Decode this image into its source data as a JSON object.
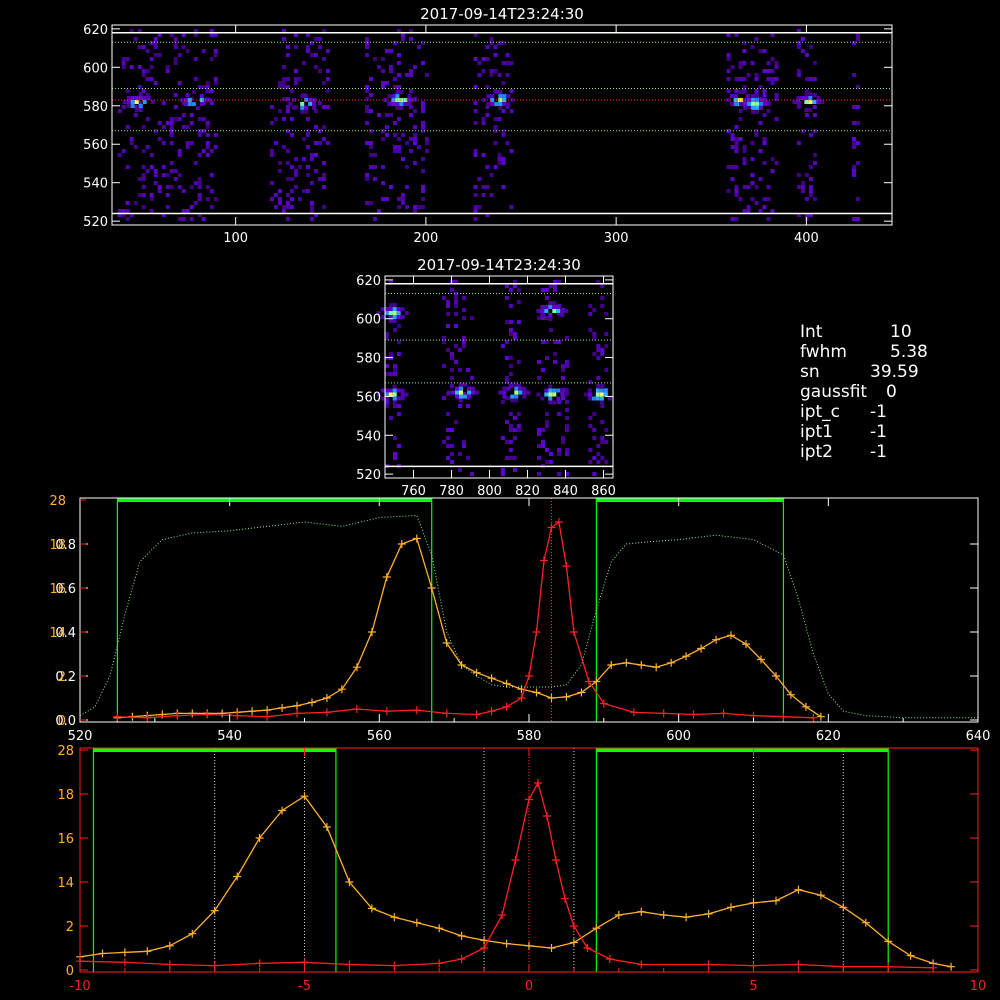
{
  "info": {
    "int": {
      "label": "Int",
      "value": "10"
    },
    "fwhm": {
      "label": "fwhm",
      "value": "5.38"
    },
    "sn": {
      "label": "sn",
      "value": "39.59"
    },
    "gaussfit": {
      "label": "gaussfit",
      "value": "0"
    },
    "ipt_c": {
      "label": "ipt_c",
      "value": "-1"
    },
    "ipt1": {
      "label": "ipt1",
      "value": "-1"
    },
    "ipt2": {
      "label": "ipt2",
      "value": "-1"
    }
  },
  "colors": {
    "axes": "#ffffff",
    "red_series": "#ff2020",
    "orange_series": "#ffb030",
    "green": "#00ff00",
    "dotted_white": "#d8d8d8",
    "dotted_green": "#90ee90",
    "dotted_red": "#ff3030"
  },
  "chart_data": [
    {
      "id": "top",
      "type": "heatmap",
      "title": "2017-09-14T23:24:30",
      "xlim": [
        35,
        445
      ],
      "ylim": [
        518,
        622
      ],
      "xticks": [
        100,
        200,
        300,
        400
      ],
      "yticks": [
        520,
        540,
        560,
        580,
        600,
        620
      ],
      "solid_hlines": [
        524,
        618
      ],
      "dotted_green_hlines": [
        567,
        589,
        613
      ],
      "dotted_red_hline": 583,
      "column_bands": [
        [
          38,
          90
        ],
        [
          118,
          148
        ],
        [
          168,
          200
        ],
        [
          225,
          245
        ],
        [
          358,
          385
        ],
        [
          395,
          405
        ],
        [
          424,
          428
        ]
      ],
      "bright_spots": [
        [
          48,
          583
        ],
        [
          78,
          584
        ],
        [
          135,
          582
        ],
        [
          185,
          584
        ],
        [
          237,
          584
        ],
        [
          365,
          584
        ],
        [
          372,
          582
        ],
        [
          400,
          583
        ]
      ]
    },
    {
      "id": "mid",
      "type": "heatmap",
      "title": "2017-09-14T23:24:30",
      "xlim": [
        745,
        865
      ],
      "ylim": [
        518,
        622
      ],
      "xticks": [
        760,
        780,
        800,
        820,
        840,
        860
      ],
      "yticks": [
        520,
        540,
        560,
        580,
        600,
        620
      ],
      "solid_hlines": [
        524,
        618
      ],
      "dotted_green_hlines": [
        567,
        589,
        613
      ],
      "column_bands": [
        [
          745,
          752
        ],
        [
          775,
          790
        ],
        [
          806,
          816
        ],
        [
          825,
          840
        ],
        [
          852,
          862
        ]
      ],
      "bright_spots": [
        [
          748,
          562
        ],
        [
          785,
          563
        ],
        [
          812,
          563
        ],
        [
          832,
          562
        ],
        [
          857,
          562
        ],
        [
          832,
          605
        ],
        [
          748,
          604
        ]
      ]
    },
    {
      "id": "spectrum",
      "type": "line",
      "xlim": [
        520,
        640
      ],
      "xticks": [
        520,
        540,
        560,
        580,
        600,
        620,
        640
      ],
      "y_left_white": {
        "lim": [
          0,
          1.0
        ],
        "ticks": [
          "0.0",
          "0.2",
          "0.4",
          "0.6",
          "0.8"
        ]
      },
      "y_left_red": {
        "lim": [
          0,
          20
        ],
        "ticks": [
          "0",
          "2",
          "14",
          "16",
          "18",
          "28"
        ],
        "tick_positions": [
          0,
          4,
          8,
          12,
          16,
          20
        ]
      },
      "green_boxes": [
        [
          525,
          567
        ],
        [
          589,
          614
        ]
      ],
      "dotted_red_vline": 583,
      "series": [
        {
          "color": "orange",
          "x": [
            525,
            527,
            529,
            531,
            533,
            535,
            537,
            539,
            541,
            543,
            545,
            547,
            549,
            551,
            553,
            555,
            557,
            559,
            561,
            563,
            565,
            567,
            569,
            571,
            573,
            575,
            577,
            579,
            581,
            583,
            585,
            587,
            589,
            591,
            593,
            595,
            597,
            599,
            601,
            603,
            605,
            607,
            609,
            611,
            613,
            615,
            617,
            619
          ],
          "y": [
            0.2,
            0.3,
            0.4,
            0.5,
            0.6,
            0.6,
            0.6,
            0.6,
            0.7,
            0.8,
            0.9,
            1.1,
            1.3,
            1.6,
            2.0,
            2.8,
            4.8,
            8.0,
            13.0,
            16.0,
            16.5,
            12.0,
            7.0,
            5.0,
            4.3,
            3.8,
            3.3,
            2.8,
            2.5,
            2.0,
            2.1,
            2.5,
            3.5,
            5.0,
            5.2,
            5.0,
            4.8,
            5.2,
            5.8,
            6.5,
            7.3,
            7.7,
            6.9,
            5.5,
            4.0,
            2.3,
            1.2,
            0.3
          ]
        },
        {
          "color": "red",
          "x": [
            525,
            529,
            533,
            537,
            541,
            545,
            549,
            553,
            557,
            561,
            565,
            569,
            573,
            575,
            577,
            579,
            580,
            581,
            582,
            583,
            584,
            585,
            586,
            588,
            590,
            594,
            598,
            602,
            606,
            610,
            614,
            618
          ],
          "y": [
            0.3,
            0.2,
            0.4,
            0.5,
            0.4,
            0.3,
            0.6,
            0.7,
            1.0,
            0.8,
            0.9,
            0.6,
            0.5,
            0.8,
            1.2,
            2.0,
            4.0,
            8.0,
            14.5,
            17.5,
            18.0,
            14.0,
            8.0,
            3.5,
            1.5,
            0.7,
            0.6,
            0.5,
            0.6,
            0.4,
            0.3,
            0.2
          ]
        },
        {
          "color": "dotted_white",
          "x": [
            520,
            522,
            524,
            526,
            528,
            531,
            535,
            540,
            545,
            550,
            555,
            560,
            565,
            567,
            569,
            571,
            573,
            575,
            577,
            579,
            581,
            583,
            585,
            587,
            589,
            591,
            593,
            596,
            600,
            605,
            610,
            614,
            616,
            618,
            620,
            622,
            625,
            630,
            635,
            640
          ],
          "y": [
            0.02,
            0.06,
            0.2,
            0.48,
            0.72,
            0.82,
            0.85,
            0.86,
            0.88,
            0.9,
            0.88,
            0.92,
            0.93,
            0.75,
            0.4,
            0.25,
            0.2,
            0.16,
            0.15,
            0.15,
            0.15,
            0.15,
            0.16,
            0.25,
            0.5,
            0.72,
            0.8,
            0.81,
            0.82,
            0.84,
            0.82,
            0.75,
            0.55,
            0.3,
            0.12,
            0.04,
            0.02,
            0.01,
            0.01,
            0.01
          ]
        }
      ]
    },
    {
      "id": "offset",
      "type": "line",
      "xlim": [
        -10,
        10
      ],
      "xticks": [
        "-10",
        "-5",
        "0",
        "5",
        "10"
      ],
      "y_red": {
        "lim": [
          0,
          20
        ],
        "ticks": [
          "0",
          "2",
          "14",
          "16",
          "18",
          "28"
        ],
        "tick_positions": [
          0,
          4,
          8,
          12,
          16,
          20
        ]
      },
      "green_boxes": [
        [
          -9.7,
          -4.3
        ],
        [
          1.5,
          8.0
        ]
      ],
      "dotted_white_vlines": [
        -7,
        -5,
        -1,
        1,
        5,
        7
      ],
      "dotted_red_vline": 0,
      "series": [
        {
          "color": "orange",
          "x": [
            -10,
            -9.5,
            -9,
            -8.5,
            -8,
            -7.5,
            -7,
            -6.5,
            -6,
            -5.5,
            -5,
            -4.5,
            -4,
            -3.5,
            -3,
            -2.5,
            -2,
            -1.5,
            -1,
            -0.5,
            0,
            0.5,
            1,
            1.5,
            2,
            2.5,
            3,
            3.5,
            4,
            4.5,
            5,
            5.5,
            6,
            6.5,
            7,
            7.5,
            8,
            8.5,
            9,
            9.4
          ],
          "y": [
            1.2,
            1.5,
            1.6,
            1.7,
            2.2,
            3.3,
            5.4,
            8.5,
            12.0,
            14.5,
            15.8,
            13.0,
            8.0,
            5.6,
            4.8,
            4.3,
            3.8,
            3.1,
            2.7,
            2.4,
            2.2,
            2.0,
            2.5,
            3.8,
            5.0,
            5.3,
            5.0,
            4.8,
            5.1,
            5.7,
            6.1,
            6.3,
            7.3,
            6.8,
            5.7,
            4.3,
            2.6,
            1.3,
            0.6,
            0.3
          ]
        },
        {
          "color": "red",
          "x": [
            -10,
            -9,
            -8,
            -7,
            -6,
            -5,
            -4,
            -3,
            -2,
            -1.5,
            -1,
            -0.6,
            -0.3,
            0,
            0.2,
            0.4,
            0.6,
            0.8,
            1,
            1.3,
            1.8,
            2.5,
            4,
            5,
            6,
            7,
            8,
            9
          ],
          "y": [
            0.8,
            0.7,
            0.5,
            0.4,
            0.6,
            0.7,
            0.5,
            0.4,
            0.6,
            1.0,
            2.0,
            5.0,
            10.0,
            15.5,
            17.0,
            14.0,
            10.0,
            6.5,
            4.0,
            2.0,
            1.0,
            0.5,
            0.5,
            0.4,
            0.5,
            0.3,
            0.3,
            0.2
          ]
        }
      ]
    }
  ]
}
